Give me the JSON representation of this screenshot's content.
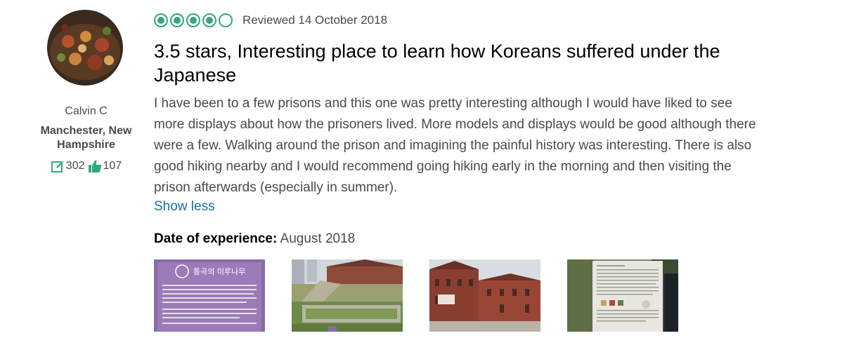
{
  "reviewer": {
    "name": "Calvin C",
    "location": "Manchester, New Hampshire",
    "contributions": "302",
    "helpful_votes": "107"
  },
  "review": {
    "rating": 4,
    "rating_max": 5,
    "date_text": "Reviewed 14 October 2018",
    "title": "3.5 stars, Interesting place to learn how Koreans suffered under the Japanese",
    "body": "I have been to a few prisons and this one was pretty interesting although I would have liked to see more displays about how the prisoners lived. More models and displays would be good although there were a few. Walking around the prison and imagining the painful history was interesting. There is also good hiking nearby and I would recommend going hiking early in the morning and then visiting the prison afterwards (especially in summer).",
    "show_less_label": "Show less",
    "date_of_experience_label": "Date of experience:",
    "date_of_experience_value": "August 2018"
  },
  "photo_sign_text": "통곡의 미루나무",
  "colors": {
    "bubble_green": "#34a87c",
    "link_blue": "#1a6d9e"
  }
}
